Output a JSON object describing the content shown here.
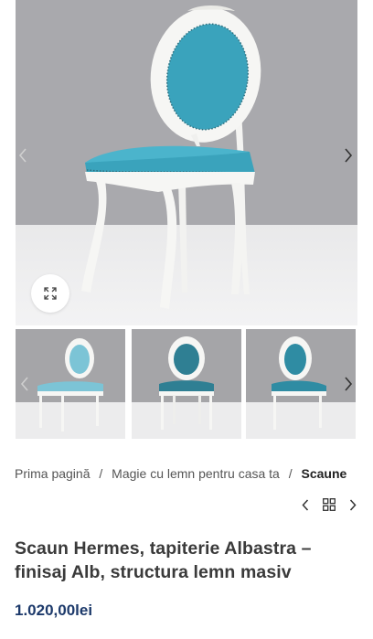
{
  "breadcrumb": {
    "items": [
      "Prima pagină",
      "Magie cu lemn pentru casa ta"
    ],
    "current": "Scaune",
    "separator": "/"
  },
  "product": {
    "title": "Scaun Hermes, tapiterie Albastra – finisaj Alb, structura lemn masiv",
    "price": "1.020,00lei"
  },
  "colors": {
    "upholstery": "#3aa3bc",
    "frame": "#f6f6f4",
    "price": "#1d3a6b"
  },
  "icons": {
    "zoom": "expand-arrows-icon",
    "prev": "chevron-left-icon",
    "next": "chevron-right-icon",
    "grid": "grid-icon"
  }
}
